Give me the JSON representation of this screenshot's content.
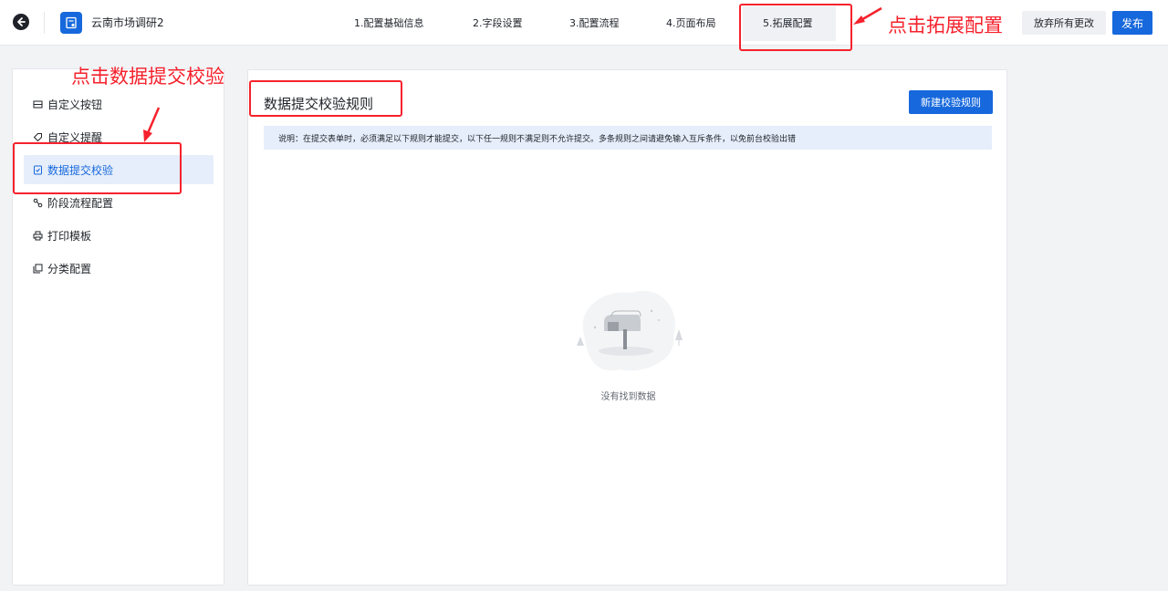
{
  "header": {
    "app_title": "云南市场调研2",
    "steps": [
      {
        "label": "1.配置基础信息"
      },
      {
        "label": "2.字段设置"
      },
      {
        "label": "3.配置流程"
      },
      {
        "label": "4.页面布局"
      },
      {
        "label": "5.拓展配置"
      }
    ],
    "discard_label": "放弃所有更改",
    "publish_label": "发布"
  },
  "sidebar": {
    "items": [
      {
        "label": "自定义按钮",
        "icon": "layout-icon"
      },
      {
        "label": "自定义提醒",
        "icon": "tag-icon"
      },
      {
        "label": "数据提交校验",
        "icon": "check-doc-icon"
      },
      {
        "label": "阶段流程配置",
        "icon": "flow-icon"
      },
      {
        "label": "打印模板",
        "icon": "printer-icon"
      },
      {
        "label": "分类配置",
        "icon": "copy-icon"
      }
    ],
    "selected_index": 2
  },
  "main": {
    "title": "数据提交校验规则",
    "new_rule_label": "新建校验规则",
    "notice": "说明：在提交表单时，必须满足以下规则才能提交，以下任一规则不满足则不允许提交。多条规则之间请避免输入互斥条件，以免前台校验出错",
    "empty_text": "没有找到数据"
  },
  "annotations": {
    "click_extend_config": "点击拓展配置",
    "click_data_validation": "点击数据提交校验"
  },
  "colors": {
    "primary": "#1668dc",
    "annotation": "#f5222d",
    "selected_bg": "#e6eefb"
  }
}
